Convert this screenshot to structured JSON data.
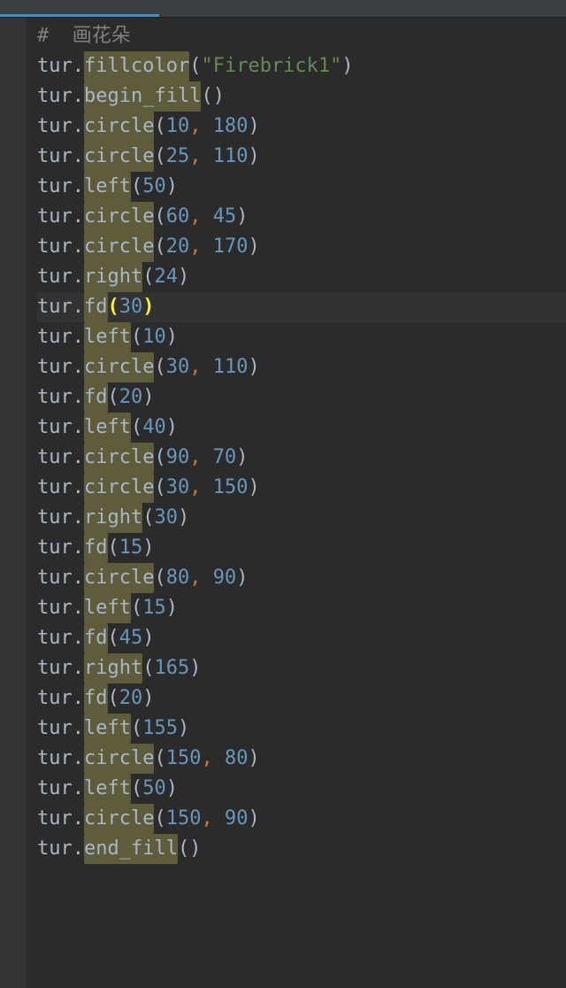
{
  "code": {
    "lines": [
      {
        "type": "comment",
        "text": "#  画花朵"
      },
      {
        "type": "call",
        "obj": "tur",
        "method": "fillcolor",
        "argtype": "str",
        "strval": "\"Firebrick1\""
      },
      {
        "type": "call",
        "obj": "tur",
        "method": "begin_fill",
        "argtype": "none"
      },
      {
        "type": "call",
        "obj": "tur",
        "method": "circle",
        "argtype": "two",
        "a": "10",
        "b": "180"
      },
      {
        "type": "call",
        "obj": "tur",
        "method": "circle",
        "argtype": "two",
        "a": "25",
        "b": "110"
      },
      {
        "type": "call",
        "obj": "tur",
        "method": "left",
        "argtype": "one",
        "a": "50"
      },
      {
        "type": "call",
        "obj": "tur",
        "method": "circle",
        "argtype": "two",
        "a": "60",
        "b": "45"
      },
      {
        "type": "call",
        "obj": "tur",
        "method": "circle",
        "argtype": "two",
        "a": "20",
        "b": "170"
      },
      {
        "type": "call",
        "obj": "tur",
        "method": "right",
        "argtype": "one",
        "a": "24"
      },
      {
        "type": "call",
        "obj": "tur",
        "method": "fd",
        "argtype": "one",
        "a": "30",
        "current": true,
        "matchparen": true
      },
      {
        "type": "call",
        "obj": "tur",
        "method": "left",
        "argtype": "one",
        "a": "10"
      },
      {
        "type": "call",
        "obj": "tur",
        "method": "circle",
        "argtype": "two",
        "a": "30",
        "b": "110"
      },
      {
        "type": "call",
        "obj": "tur",
        "method": "fd",
        "argtype": "one",
        "a": "20"
      },
      {
        "type": "call",
        "obj": "tur",
        "method": "left",
        "argtype": "one",
        "a": "40"
      },
      {
        "type": "call",
        "obj": "tur",
        "method": "circle",
        "argtype": "two",
        "a": "90",
        "b": "70"
      },
      {
        "type": "call",
        "obj": "tur",
        "method": "circle",
        "argtype": "two",
        "a": "30",
        "b": "150"
      },
      {
        "type": "call",
        "obj": "tur",
        "method": "right",
        "argtype": "one",
        "a": "30"
      },
      {
        "type": "call",
        "obj": "tur",
        "method": "fd",
        "argtype": "one",
        "a": "15"
      },
      {
        "type": "call",
        "obj": "tur",
        "method": "circle",
        "argtype": "two",
        "a": "80",
        "b": "90"
      },
      {
        "type": "call",
        "obj": "tur",
        "method": "left",
        "argtype": "one",
        "a": "15"
      },
      {
        "type": "call",
        "obj": "tur",
        "method": "fd",
        "argtype": "one",
        "a": "45"
      },
      {
        "type": "call",
        "obj": "tur",
        "method": "right",
        "argtype": "one",
        "a": "165"
      },
      {
        "type": "call",
        "obj": "tur",
        "method": "fd",
        "argtype": "one",
        "a": "20"
      },
      {
        "type": "call",
        "obj": "tur",
        "method": "left",
        "argtype": "one",
        "a": "155"
      },
      {
        "type": "call",
        "obj": "tur",
        "method": "circle",
        "argtype": "two",
        "a": "150",
        "b": "80"
      },
      {
        "type": "call",
        "obj": "tur",
        "method": "left",
        "argtype": "one",
        "a": "50"
      },
      {
        "type": "call",
        "obj": "tur",
        "method": "circle",
        "argtype": "two",
        "a": "150",
        "b": "90"
      },
      {
        "type": "call",
        "obj": "tur",
        "method": "end_fill",
        "argtype": "none"
      }
    ]
  }
}
